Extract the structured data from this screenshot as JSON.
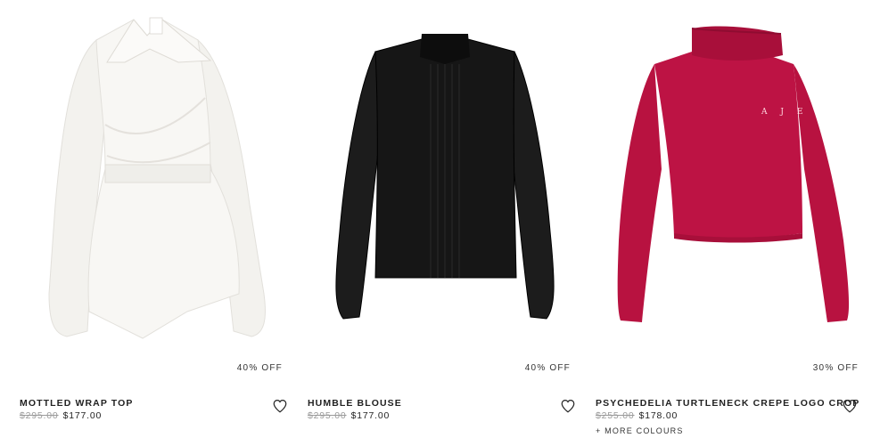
{
  "products": [
    {
      "name": "MOTTLED WRAP TOP",
      "was_price": "$295.00",
      "price": "$177.00",
      "discount": "40% OFF",
      "image_alt": "white wrap top",
      "color": "#f6f5f2"
    },
    {
      "name": "HUMBLE BLOUSE",
      "was_price": "$295.00",
      "price": "$177.00",
      "discount": "40% OFF",
      "image_alt": "black sheer blouse",
      "color": "#111111"
    },
    {
      "name": "PSYCHEDELIA TURTLENECK CREPE LOGO CROP",
      "was_price": "$255.00",
      "price": "$178.00",
      "discount": "30% OFF",
      "more_colours": "+ MORE COLOURS",
      "image_alt": "red turtleneck",
      "color": "#b5103a",
      "logo_text": "A J E"
    }
  ],
  "icons": {
    "wishlist": "heart-outline-icon"
  }
}
